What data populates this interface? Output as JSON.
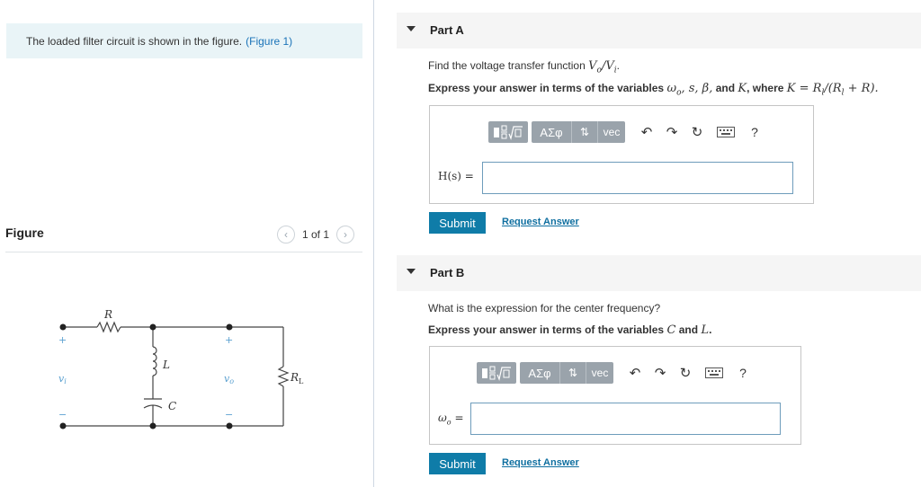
{
  "left": {
    "intro_text": "The loaded filter circuit is shown in the figure.",
    "intro_link": "(Figure 1)",
    "figure_title": "Figure",
    "pager_count": "1 of 1",
    "prev_icon": "chevron-left-icon",
    "next_icon": "chevron-right-icon",
    "circuit": {
      "R": "R",
      "L": "L",
      "C": "C",
      "RL": "R",
      "RL_sub": "L",
      "vi": "v",
      "vi_sub": "i",
      "vo": "v",
      "vo_sub": "o",
      "plus": "+",
      "minus": "−"
    }
  },
  "partA": {
    "label": "Part A",
    "question": "Find the voltage transfer function",
    "V_o": "V",
    "o_sub": "o",
    "slash": "/",
    "V_i": "V",
    "i_sub": "i",
    "dot": ".",
    "express_prefix": "Express your answer in terms of the variables",
    "vars": "ω",
    "vars_sub": "o",
    "vars_rest": ", s, β,",
    "and": "and",
    "K": "K",
    "where": ", where",
    "K_def": "K = R",
    "K_def_sub": "l",
    "K_def_mid": "/(R",
    "K_def_sub2": "l",
    "K_def_end": " + R).",
    "field_label": "H(s) =",
    "submit": "Submit",
    "request": "Request Answer"
  },
  "partB": {
    "label": "Part B",
    "question": "What is the expression for the center frequency?",
    "express_prefix": "Express your answer in terms of the variables",
    "C": "C",
    "and": "and",
    "L": "L",
    "period": ".",
    "field_label": "ω",
    "field_label_sub": "o",
    "field_label_eq": " =",
    "submit": "Submit",
    "request": "Request Answer"
  },
  "toolbar": {
    "templates_icon": "fraction-sqrt-template-icon",
    "greek": "ΑΣφ",
    "arrows": "⇅",
    "vec": "vec",
    "undo_icon": "undo-icon",
    "redo_icon": "redo-icon",
    "reset_icon": "reset-icon",
    "keyboard_icon": "keyboard-icon",
    "help": "?"
  },
  "colors": {
    "accent": "#0f7ca8",
    "link": "#1a73b8",
    "toolbar_gray": "#9aa3ab",
    "intro_bg": "#e9f4f7"
  }
}
